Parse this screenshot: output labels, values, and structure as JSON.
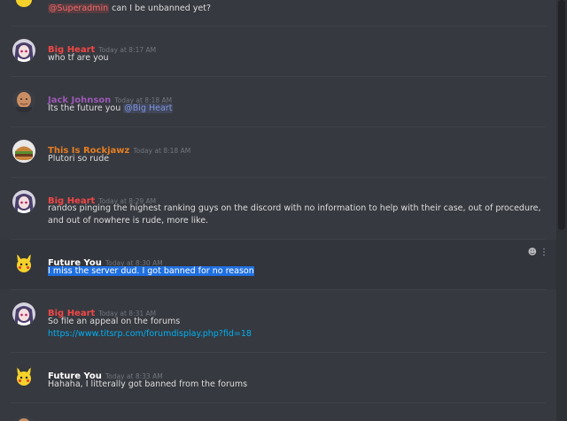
{
  "colors": {
    "red_user": "#f04747",
    "purple_user": "#9b59b6",
    "orange_user": "#e67e22",
    "white_user": "#ffffff",
    "selection": "#1f6fe0",
    "link": "#00b0f4"
  },
  "messages": [
    {
      "text_mention": "@Superadmin",
      "text": " can I be unbanned yet?"
    },
    {
      "username": "Big Heart",
      "timestamp": "Today at 8:17 AM",
      "text": "who tf are you",
      "avatar_icon": "anime-girl-avatar-icon"
    },
    {
      "username": "Jack Johnson",
      "timestamp": "Today at 8:18 AM",
      "text": "Its the future you ",
      "mention": "@Big Heart",
      "avatar_icon": "bald-man-avatar-icon"
    },
    {
      "username": "This Is Rockjawz",
      "timestamp": "Today at 8:18 AM",
      "text": "Plutori so rude",
      "avatar_icon": "burger-avatar-icon"
    },
    {
      "username": "Big Heart",
      "timestamp": "Today at 8:29 AM",
      "text": "randos pinging the highest ranking guys on the discord with no information to help with their case, out of procedure, and out of nowhere is rude, more like.",
      "avatar_icon": "anime-girl-avatar-icon"
    },
    {
      "username": "Future You",
      "timestamp": "Today at 8:30 AM",
      "text": "I miss the server dud. I got banned for no reason",
      "avatar_icon": "pikachu-avatar-icon"
    },
    {
      "username": "Big Heart",
      "timestamp": "Today at 8:31 AM",
      "text": "So file an appeal on the forums",
      "link": "https://www.titsrp.com/forumdisplay.php?fid=18",
      "avatar_icon": "anime-girl-avatar-icon"
    },
    {
      "username": "Future You",
      "timestamp": "Today at 8:33 AM",
      "text": "Hahaha, I litterally got banned from the forums",
      "avatar_icon": "pikachu-avatar-icon"
    }
  ]
}
